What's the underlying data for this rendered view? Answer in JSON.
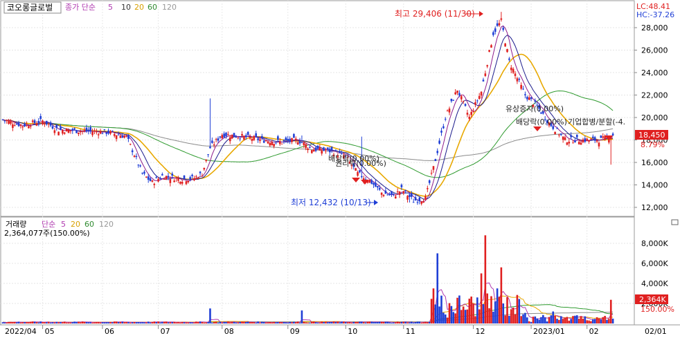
{
  "header": {
    "stock_name": "코오롱글로벌",
    "ma_label": "종가 단순",
    "ma_periods": [
      "5",
      "10",
      "20",
      "60",
      "120"
    ],
    "lc_label": "LC:48.41",
    "hc_label": "HC:-37.26"
  },
  "volume_header": {
    "label": "거래량",
    "ma_label": "단순",
    "ma_periods": [
      "5",
      "20",
      "60",
      "120"
    ],
    "current": "2,364,077주(150.00%)"
  },
  "annotations": {
    "high": "최고 29,406 (11/30)",
    "low": "최저 12,432 (10/13)",
    "events": [
      "유상증자(0.00%)",
      "배당락(0.00%)",
      "기업합병/분할(-4.",
      "배당락(0.00%)",
      "권리락(0.00%)"
    ]
  },
  "price_badge": "18,450",
  "pct_badge": "8.79%",
  "vol_badge": "2,364K",
  "vol_pct_badge": "150.00%",
  "colors": {
    "up": "#e02020",
    "down": "#1f3fd6",
    "ma5": "#8b1a8b",
    "ma10": "#1a1a8b",
    "ma20": "#e8a800",
    "ma60": "#2e9a2e",
    "ma120": "#8a8a8a",
    "ma5_label": "#b03ab0",
    "ma10_label": "#333333",
    "ma20_label": "#d8a000",
    "ma60_label": "#2e8a2e",
    "ma120_label": "#999999"
  },
  "chart_data": {
    "type": "candlestick",
    "x_ticks": [
      "2022/04",
      "05",
      "06",
      "07",
      "08",
      "09",
      "10",
      "11",
      "12",
      "2023/01",
      "02",
      "02/01"
    ],
    "price_axis": [
      "28,000",
      "26,000",
      "24,000",
      "22,000",
      "20,000",
      "18,000",
      "16,000",
      "14,000",
      "12,000"
    ],
    "price_axis_values": [
      28000,
      26000,
      24000,
      22000,
      20000,
      18000,
      16000,
      14000,
      12000
    ],
    "volume_axis": [
      "8,000K",
      "6,000K",
      "4,000K",
      "2,000K"
    ],
    "volume_axis_values": [
      8000,
      6000,
      4000,
      2000
    ],
    "ohlc_keypoints": [
      [
        0,
        19800
      ],
      [
        10,
        19300
      ],
      [
        20,
        19700
      ],
      [
        28,
        18900
      ],
      [
        40,
        18800
      ],
      [
        52,
        18700
      ],
      [
        62,
        18300
      ],
      [
        66,
        16700
      ],
      [
        70,
        15000
      ],
      [
        75,
        14200
      ],
      [
        80,
        14800
      ],
      [
        90,
        14500
      ],
      [
        96,
        14600
      ],
      [
        100,
        15000
      ],
      [
        104,
        17300
      ],
      [
        110,
        18500
      ],
      [
        120,
        18300
      ],
      [
        130,
        18000
      ],
      [
        140,
        17800
      ],
      [
        148,
        18000
      ],
      [
        155,
        17200
      ],
      [
        165,
        17000
      ],
      [
        172,
        16500
      ],
      [
        178,
        15000
      ],
      [
        184,
        14400
      ],
      [
        190,
        13300
      ],
      [
        196,
        13000
      ],
      [
        200,
        13600
      ],
      [
        206,
        12600
      ],
      [
        212,
        12800
      ],
      [
        216,
        15500
      ],
      [
        222,
        20000
      ],
      [
        228,
        22500
      ],
      [
        234,
        20000
      ],
      [
        240,
        22300
      ],
      [
        246,
        27500
      ],
      [
        250,
        28600
      ],
      [
        254,
        25000
      ],
      [
        258,
        23500
      ],
      [
        262,
        22000
      ],
      [
        268,
        21000
      ],
      [
        274,
        19500
      ],
      [
        278,
        18800
      ],
      [
        282,
        18000
      ],
      [
        300,
        18000
      ],
      [
        306,
        18450
      ]
    ],
    "spikes": [
      [
        104,
        21700
      ],
      [
        150,
        18400
      ],
      [
        180,
        18300
      ]
    ],
    "volume_spikes": [
      [
        104,
        1500
      ],
      [
        150,
        1300
      ],
      [
        216,
        3500
      ],
      [
        218,
        7000
      ],
      [
        240,
        5000
      ],
      [
        242,
        8800
      ],
      [
        248,
        3500
      ],
      [
        250,
        5600
      ],
      [
        276,
        1200
      ],
      [
        305,
        2364
      ]
    ],
    "ma_lines": [
      "ma5",
      "ma10",
      "ma20",
      "ma60",
      "ma120"
    ]
  }
}
